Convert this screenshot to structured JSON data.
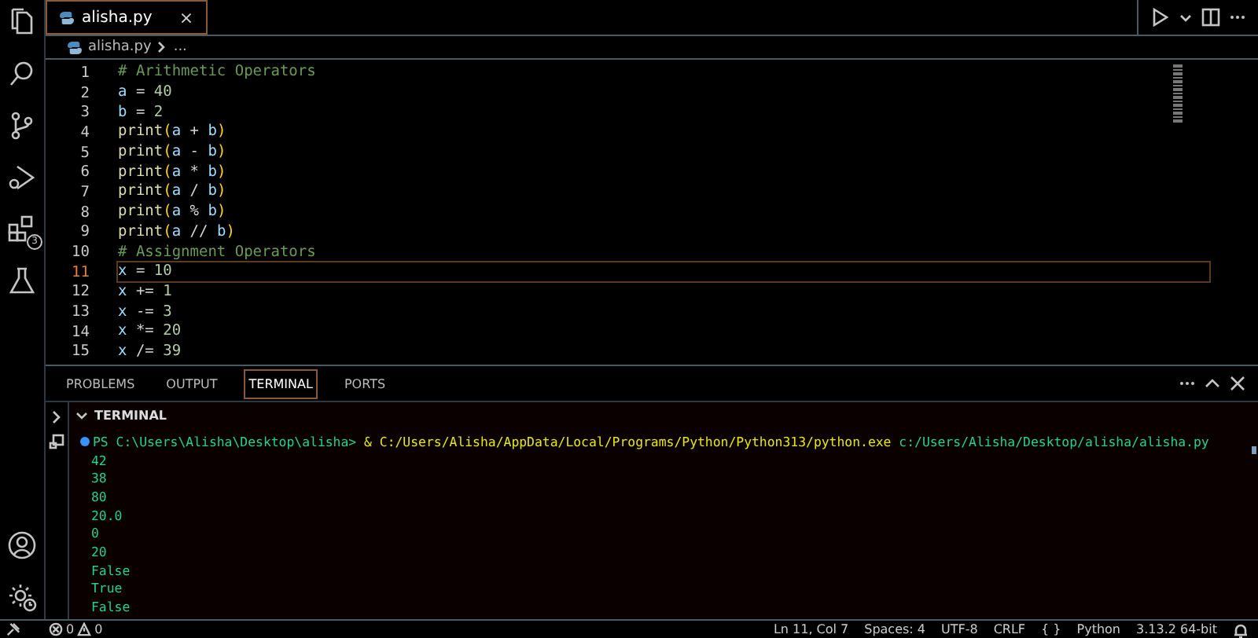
{
  "activity_bar": {
    "extensions_badge": "3"
  },
  "editor_tabs": [
    {
      "label": "alisha.py",
      "selected": true,
      "close": "×"
    }
  ],
  "breadcrumbs": {
    "file": "alisha.py",
    "rest": "..."
  },
  "code_lines": [
    {
      "number": "1",
      "current": false,
      "tokens": [
        {
          "kind": "comment",
          "text": "# Arithmetic Operators"
        }
      ]
    },
    {
      "number": "2",
      "current": false,
      "tokens": [
        {
          "kind": "var",
          "text": "a"
        },
        {
          "kind": "op",
          "text": " = "
        },
        {
          "kind": "num",
          "text": "40"
        }
      ]
    },
    {
      "number": "3",
      "current": false,
      "tokens": [
        {
          "kind": "var",
          "text": "b"
        },
        {
          "kind": "op",
          "text": " = "
        },
        {
          "kind": "num",
          "text": "2"
        }
      ]
    },
    {
      "number": "4",
      "current": false,
      "tokens": [
        {
          "kind": "func",
          "text": "print"
        },
        {
          "kind": "paren",
          "text": "("
        },
        {
          "kind": "var",
          "text": "a"
        },
        {
          "kind": "op",
          "text": " + "
        },
        {
          "kind": "var",
          "text": "b"
        },
        {
          "kind": "paren",
          "text": ")"
        }
      ]
    },
    {
      "number": "5",
      "current": false,
      "tokens": [
        {
          "kind": "func",
          "text": "print"
        },
        {
          "kind": "paren",
          "text": "("
        },
        {
          "kind": "var",
          "text": "a"
        },
        {
          "kind": "op",
          "text": " - "
        },
        {
          "kind": "var",
          "text": "b"
        },
        {
          "kind": "paren",
          "text": ")"
        }
      ]
    },
    {
      "number": "6",
      "current": false,
      "tokens": [
        {
          "kind": "func",
          "text": "print"
        },
        {
          "kind": "paren",
          "text": "("
        },
        {
          "kind": "var",
          "text": "a"
        },
        {
          "kind": "op",
          "text": " * "
        },
        {
          "kind": "var",
          "text": "b"
        },
        {
          "kind": "paren",
          "text": ")"
        }
      ]
    },
    {
      "number": "7",
      "current": false,
      "tokens": [
        {
          "kind": "func",
          "text": "print"
        },
        {
          "kind": "paren",
          "text": "("
        },
        {
          "kind": "var",
          "text": "a"
        },
        {
          "kind": "op",
          "text": " / "
        },
        {
          "kind": "var",
          "text": "b"
        },
        {
          "kind": "paren",
          "text": ")"
        }
      ]
    },
    {
      "number": "8",
      "current": false,
      "tokens": [
        {
          "kind": "func",
          "text": "print"
        },
        {
          "kind": "paren",
          "text": "("
        },
        {
          "kind": "var",
          "text": "a"
        },
        {
          "kind": "op",
          "text": " % "
        },
        {
          "kind": "var",
          "text": "b"
        },
        {
          "kind": "paren",
          "text": ")"
        }
      ]
    },
    {
      "number": "9",
      "current": false,
      "tokens": [
        {
          "kind": "func",
          "text": "print"
        },
        {
          "kind": "paren",
          "text": "("
        },
        {
          "kind": "var",
          "text": "a"
        },
        {
          "kind": "op",
          "text": " // "
        },
        {
          "kind": "var",
          "text": "b"
        },
        {
          "kind": "paren",
          "text": ")"
        }
      ]
    },
    {
      "number": "10",
      "current": false,
      "tokens": [
        {
          "kind": "comment",
          "text": "# Assignment Operators"
        }
      ]
    },
    {
      "number": "11",
      "current": true,
      "tokens": [
        {
          "kind": "var",
          "text": "x"
        },
        {
          "kind": "op",
          "text": " = "
        },
        {
          "kind": "num",
          "text": "10"
        }
      ]
    },
    {
      "number": "12",
      "current": false,
      "tokens": [
        {
          "kind": "var",
          "text": "x"
        },
        {
          "kind": "op",
          "text": " += "
        },
        {
          "kind": "num",
          "text": "1"
        }
      ]
    },
    {
      "number": "13",
      "current": false,
      "tokens": [
        {
          "kind": "var",
          "text": "x"
        },
        {
          "kind": "op",
          "text": " -= "
        },
        {
          "kind": "num",
          "text": "3"
        }
      ]
    },
    {
      "number": "14",
      "current": false,
      "tokens": [
        {
          "kind": "var",
          "text": "x"
        },
        {
          "kind": "op",
          "text": " *= "
        },
        {
          "kind": "num",
          "text": "20"
        }
      ]
    },
    {
      "number": "15",
      "current": false,
      "tokens": [
        {
          "kind": "var",
          "text": "x"
        },
        {
          "kind": "op",
          "text": " /= "
        },
        {
          "kind": "num",
          "text": "39"
        }
      ]
    }
  ],
  "panel_tabs": [
    {
      "label": "PROBLEMS",
      "selected": false
    },
    {
      "label": "OUTPUT",
      "selected": false
    },
    {
      "label": "TERMINAL",
      "selected": true
    },
    {
      "label": "PORTS",
      "selected": false
    }
  ],
  "terminal": {
    "header": "TERMINAL",
    "command": [
      {
        "kind": "prompt",
        "text": "PS C:\\Users\\Alisha\\Desktop\\alisha>"
      },
      {
        "kind": "exe",
        "text": "& C:/Users/Alisha/AppData/Local/Programs/Python/Python313/python.exe"
      },
      {
        "kind": "arg",
        "text": "c:/Users/Alisha/Desktop/alisha/alisha.py"
      }
    ],
    "output": [
      "42",
      "38",
      "80",
      "20.0",
      "0",
      "20",
      "False",
      "True",
      "False"
    ]
  },
  "status_bar": {
    "errors": "0",
    "warnings": "0",
    "items": [
      "Ln 11, Col 7",
      "Spaces: 4",
      "UTF-8",
      "CRLF",
      "{ }",
      "Python",
      "3.13.2 64-bit"
    ]
  }
}
